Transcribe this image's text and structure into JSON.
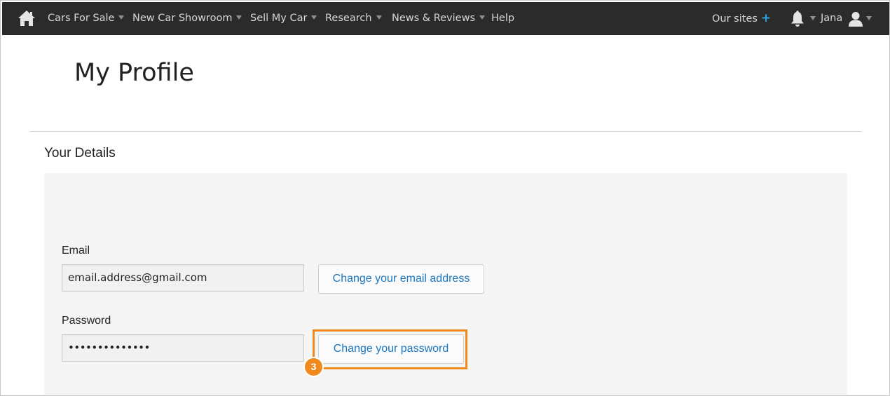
{
  "nav": {
    "items": [
      {
        "label": "Cars For Sale",
        "dropdown": true
      },
      {
        "label": "New Car Showroom",
        "dropdown": true
      },
      {
        "label": "Sell My Car",
        "dropdown": true
      },
      {
        "label": "Research",
        "dropdown": true
      },
      {
        "label": "News & Reviews",
        "dropdown": true
      },
      {
        "label": "Help",
        "dropdown": false
      }
    ],
    "our_sites": "Our sites",
    "our_sites_icon": "+",
    "user_name": "Jana",
    "accent_color": "#2aa0e0",
    "background_color": "#2b2b2b"
  },
  "page": {
    "title": "My Profile",
    "section_title": "Your Details"
  },
  "form": {
    "email_label": "Email",
    "email_value": "email.address@gmail.com",
    "email_button": "Change your email address",
    "password_label": "Password",
    "password_value": "••••••••••••••",
    "password_button": "Change your password"
  },
  "annotation": {
    "step_number": "3",
    "highlight_color": "#f08a1c"
  },
  "link_color": "#1b78c2"
}
